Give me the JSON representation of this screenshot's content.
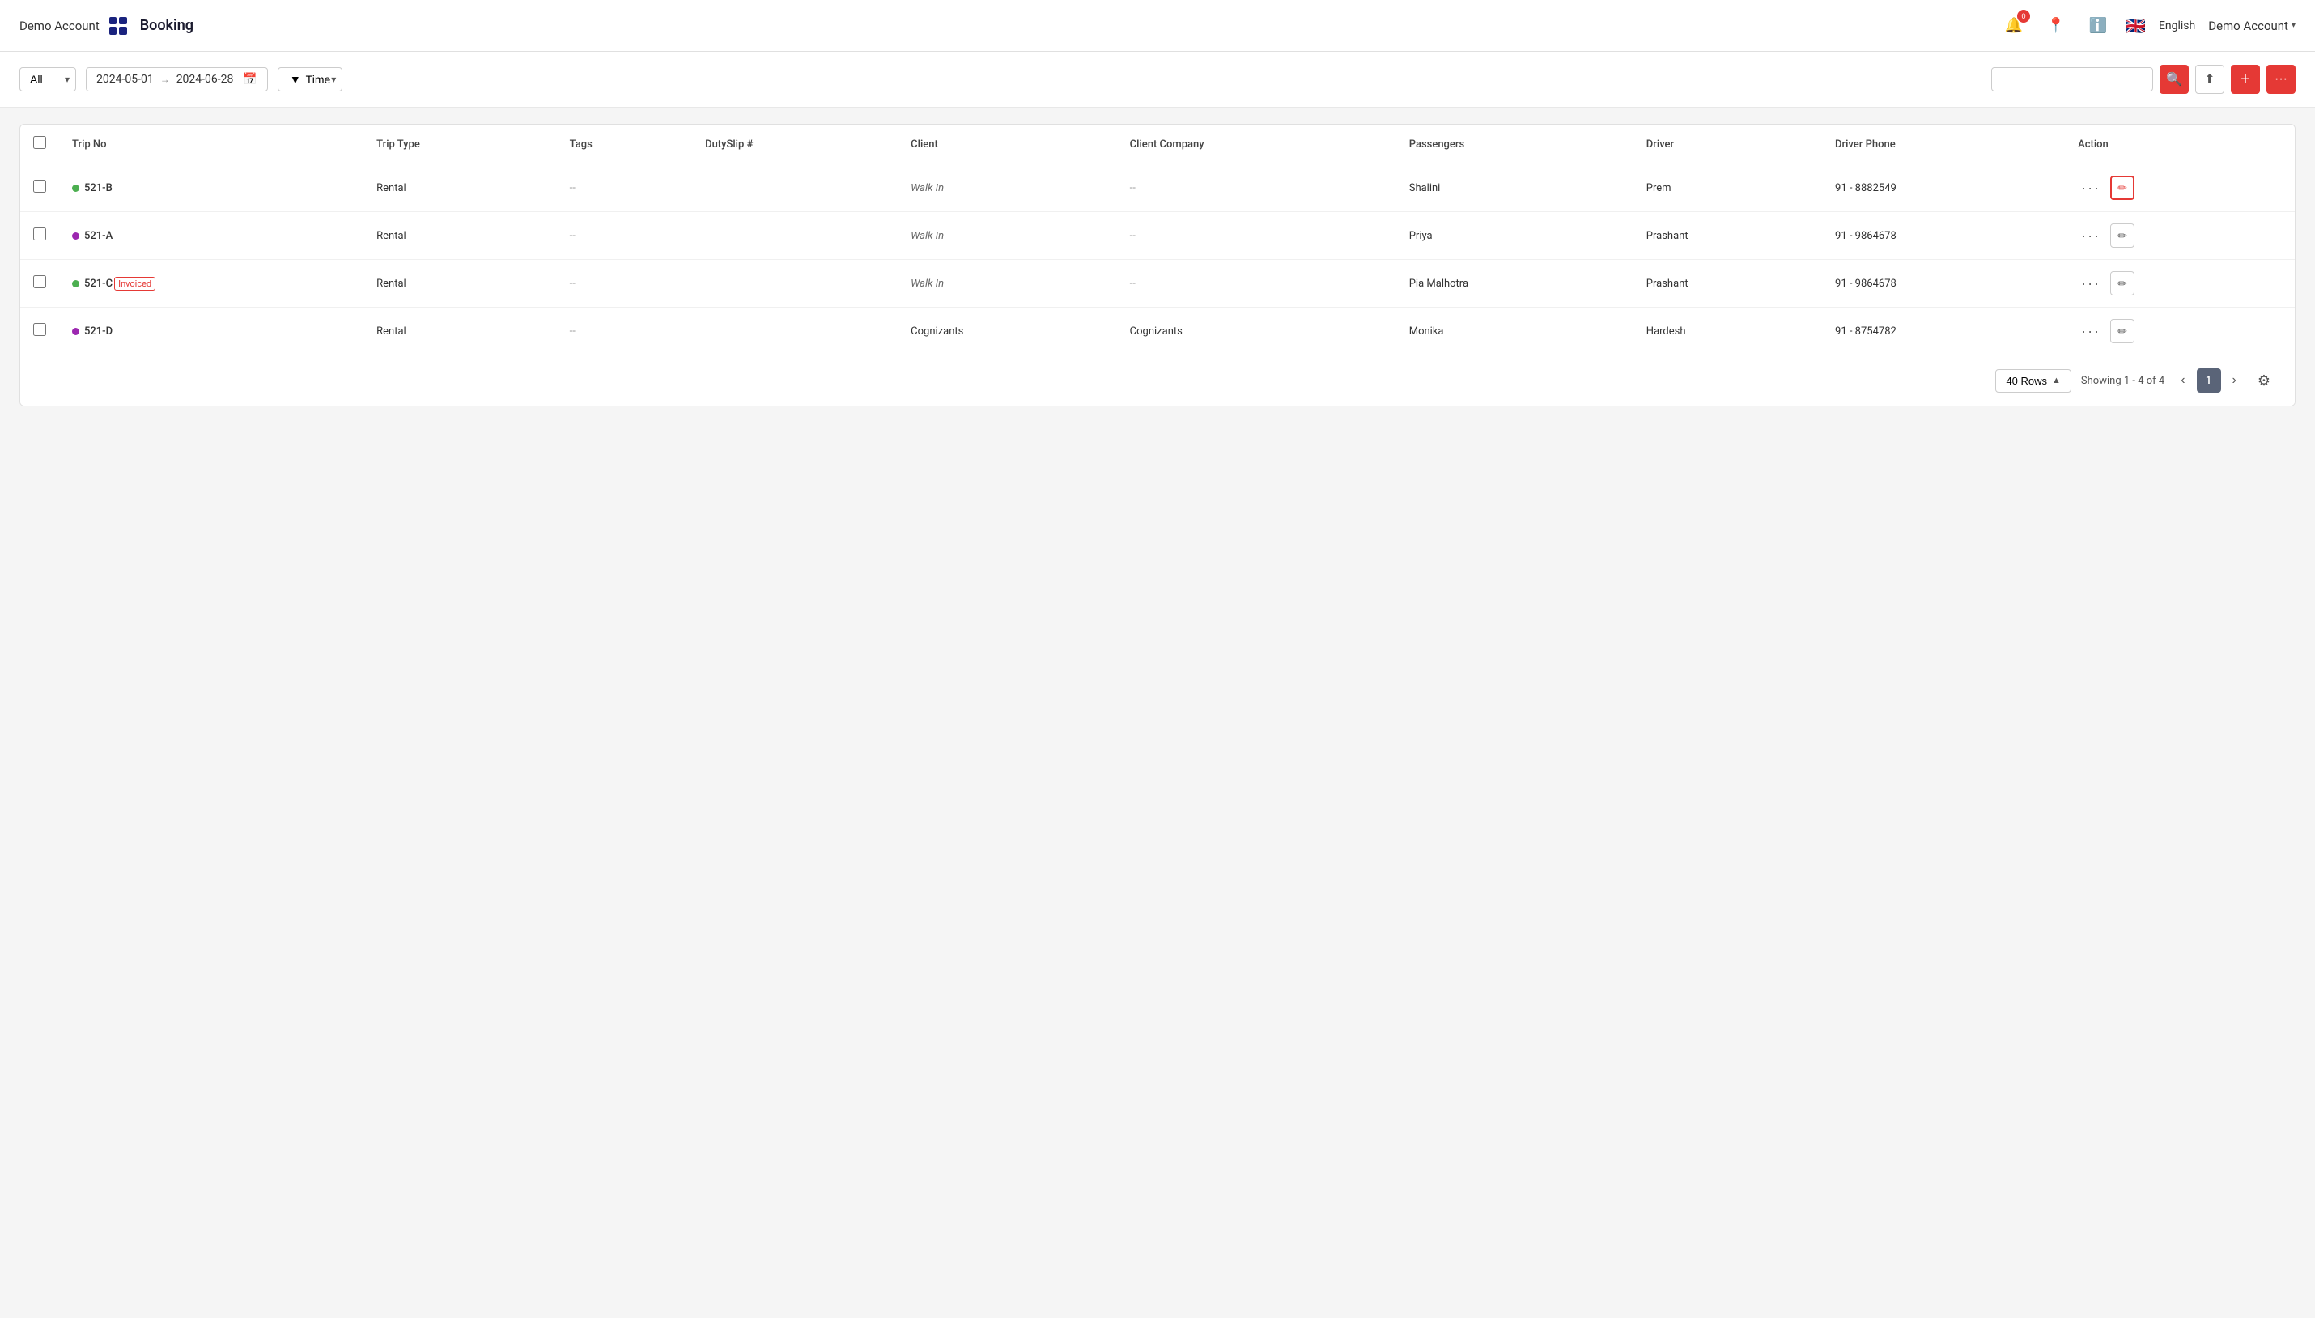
{
  "header": {
    "demo_account_left": "Demo Account",
    "app_title": "Booking",
    "notification_count": "0",
    "language": "English",
    "demo_account_right": "Demo Account",
    "grid_icon_label": "apps"
  },
  "toolbar": {
    "filter_all_label": "All",
    "date_from": "2024-05-01",
    "date_to": "2024-06-28",
    "filter_time_label": "Time",
    "search_placeholder": "",
    "search_btn_label": "🔍",
    "upload_btn_label": "⬆",
    "add_btn_label": "+",
    "more_btn_label": "···"
  },
  "table": {
    "columns": [
      "Trip No",
      "Trip Type",
      "Tags",
      "DutySlip #",
      "Client",
      "Client Company",
      "Passengers",
      "Driver",
      "Driver Phone",
      "Action"
    ],
    "rows": [
      {
        "id": "row-1",
        "status_color": "green",
        "trip_no": "521-B",
        "invoiced": false,
        "trip_type": "Rental",
        "tags": "--",
        "duty_slip": "",
        "client": "Walk In",
        "client_company": "--",
        "passengers": "Shalini",
        "driver": "Prem",
        "driver_phone": "91 - 8882549",
        "action_highlight": true
      },
      {
        "id": "row-2",
        "status_color": "purple",
        "trip_no": "521-A",
        "invoiced": false,
        "trip_type": "Rental",
        "tags": "--",
        "duty_slip": "",
        "client": "Walk In",
        "client_company": "--",
        "passengers": "Priya",
        "driver": "Prashant",
        "driver_phone": "91 - 9864678",
        "action_highlight": false
      },
      {
        "id": "row-3",
        "status_color": "green",
        "trip_no": "521-C",
        "invoiced": true,
        "invoiced_label": "Invoiced",
        "trip_type": "Rental",
        "tags": "--",
        "duty_slip": "",
        "client": "Walk In",
        "client_company": "--",
        "passengers": "Pia Malhotra",
        "driver": "Prashant",
        "driver_phone": "91 - 9864678",
        "action_highlight": false
      },
      {
        "id": "row-4",
        "status_color": "purple",
        "trip_no": "521-D",
        "invoiced": false,
        "trip_type": "Rental",
        "tags": "--",
        "duty_slip": "",
        "client": "Cognizants",
        "client_company": "Cognizants",
        "passengers": "Monika",
        "driver": "Hardesh",
        "driver_phone": "91 - 8754782",
        "action_highlight": false
      }
    ]
  },
  "pagination": {
    "rows_per_page": "40 Rows",
    "showing_text": "Showing  1 - 4 of 4",
    "current_page": "1"
  }
}
